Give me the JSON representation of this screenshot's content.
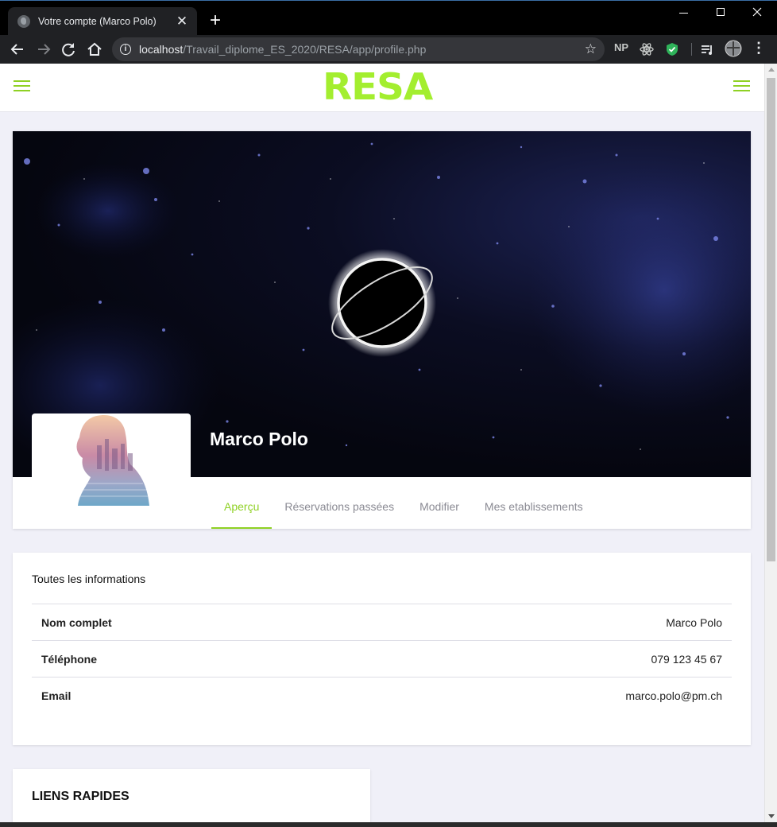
{
  "browser": {
    "tab_title": "Votre compte (Marco Polo)",
    "tab_close": "✕",
    "new_tab": "+",
    "url_host": "localhost",
    "url_path": "/Travail_diplome_ES_2020/RESA/app/profile.php",
    "info_glyph": "i",
    "star_glyph": "☆",
    "extensions": [
      "NP"
    ]
  },
  "header": {
    "logo": "RESA",
    "accent_color": "#8fd124"
  },
  "profile": {
    "name": "Marco Polo",
    "tabs": [
      "Aperçu",
      "Réservations passées",
      "Modifier",
      "Mes etablissements"
    ],
    "active_tab": "Aperçu"
  },
  "info": {
    "title": "Toutes les informations",
    "rows": [
      {
        "label": "Nom complet",
        "value": "Marco Polo"
      },
      {
        "label": "Téléphone",
        "value": "079 123 45 67"
      },
      {
        "label": "Email",
        "value": "marco.polo@pm.ch"
      }
    ]
  },
  "links": {
    "title": "LIENS RAPIDES"
  }
}
